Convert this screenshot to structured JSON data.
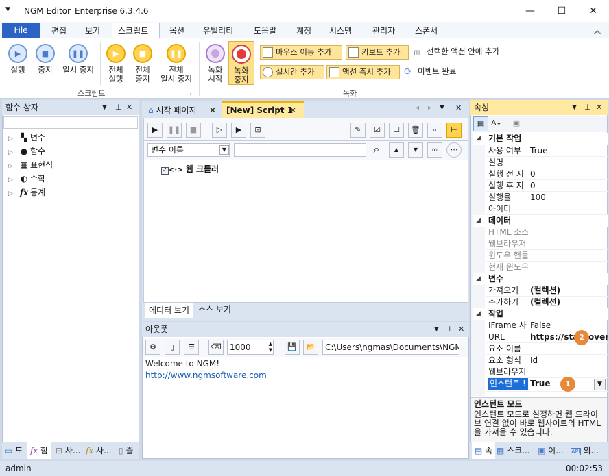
{
  "window": {
    "title": "NGM Editor",
    "edition": "Enterprise 6.3.4.6"
  },
  "menu": {
    "file": "File",
    "items": [
      "편집",
      "보기",
      "스크립트",
      "옵션",
      "유틸리티",
      "도움말",
      "계정",
      "시스템",
      "관리자",
      "스폰서"
    ]
  },
  "ribbon": {
    "script_group": "스크립트",
    "record_group": "녹화",
    "buttons": {
      "run": "실행",
      "stop": "중지",
      "pause": "일시 중지",
      "run_all_1": "전체",
      "run_all_2": "실행",
      "stop_all_1": "전체",
      "stop_all_2": "중지",
      "pause_all_1": "전체",
      "pause_all_2": "일시 중지",
      "rec_start_1": "녹화",
      "rec_start_2": "시작",
      "rec_stop_1": "녹화",
      "rec_stop_2": "중지"
    },
    "record_items": {
      "mouse_move": "마우스 이동 추가",
      "keyboard": "키보드 추가",
      "in_action": "선택한 액션 안에 추가",
      "realtime": "실시간 추가",
      "action_now": "액션 즉시 추가",
      "event_done": "이벤트 완료"
    }
  },
  "function_box": {
    "title": "함수 상자",
    "items": [
      {
        "icon": "variable-icon",
        "label": "변수"
      },
      {
        "icon": "function-icon",
        "label": "함수"
      },
      {
        "icon": "expression-icon",
        "label": "표현식"
      },
      {
        "icon": "math-icon",
        "label": "수학"
      },
      {
        "icon": "statistics-icon",
        "label": "통계"
      }
    ],
    "bottom_tabs": [
      "도",
      "함",
      "사...",
      "사...",
      "즐"
    ]
  },
  "editor": {
    "tabs": [
      "시작 페이지",
      "[New] Script 1"
    ],
    "var_dropdown": "변수 이름",
    "tree_item": "웹 크롤러",
    "view_tabs": [
      "에디터 보기",
      "소스 보기"
    ]
  },
  "output": {
    "title": "아웃풋",
    "count": "1000",
    "path": "C:\\Users\\ngmas\\Documents\\NGM6\\",
    "line1": "Welcome to NGM!",
    "link": "http://www.ngmsoftware.com"
  },
  "properties": {
    "title": "속성",
    "categories": [
      {
        "name": "기본 작업",
        "rows": [
          {
            "n": "사용 여부",
            "v": "True"
          },
          {
            "n": "설명",
            "v": ""
          },
          {
            "n": "실행 전 지",
            "v": "0"
          },
          {
            "n": "실행 후 지",
            "v": "0"
          },
          {
            "n": "실행율",
            "v": "100"
          },
          {
            "n": "아이디",
            "v": ""
          }
        ]
      },
      {
        "name": "데이터",
        "rows": [
          {
            "n": "HTML 소스",
            "v": ""
          },
          {
            "n": "웹브라우저",
            "v": ""
          },
          {
            "n": "윈도우 핸들",
            "v": ""
          },
          {
            "n": "현재 윈도우",
            "v": ""
          }
        ]
      },
      {
        "name": "변수",
        "rows": [
          {
            "n": "가져오기",
            "v": "(컬렉션)"
          },
          {
            "n": "추가하기",
            "v": "(컬렉션)"
          }
        ]
      },
      {
        "name": "작업",
        "rows": [
          {
            "n": "IFrame 사",
            "v": "False"
          },
          {
            "n": "URL",
            "v": "https://stackoverflow"
          },
          {
            "n": "요소 이름",
            "v": ""
          },
          {
            "n": "요소 형식",
            "v": "Id"
          },
          {
            "n": "웹브라우저",
            "v": ""
          },
          {
            "n": "인스턴트 !",
            "v": "True"
          }
        ]
      }
    ],
    "desc_title": "인스턴트 모드",
    "desc_text": "인스턴트 모드로 설정하면 웹 드라이브 연결 없이 바로 웹사이트의 HTML을 가져올 수 있습니다.",
    "badge1": "1",
    "badge2": "2",
    "bottom_tabs": [
      "속",
      "스크...",
      "이...",
      "외..."
    ]
  },
  "status": {
    "user": "admin",
    "time": "00:02:53"
  }
}
